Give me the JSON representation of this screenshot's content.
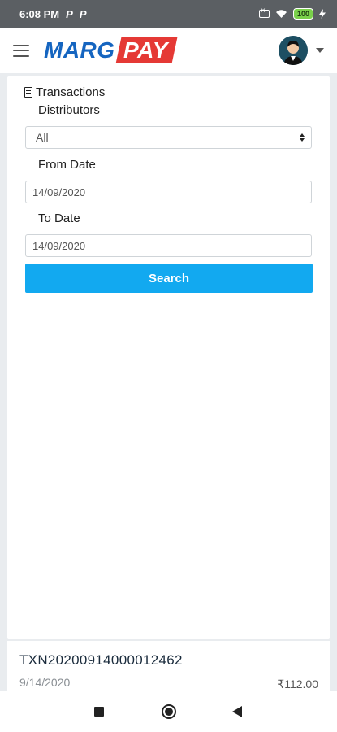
{
  "status_bar": {
    "time": "6:08 PM",
    "notif_marks": [
      "P",
      "P"
    ],
    "battery": "100"
  },
  "header": {
    "logo_left": "MARG",
    "logo_right": "PAY"
  },
  "transactions_form": {
    "title": "Transactions",
    "distributors_label": "Distributors",
    "distributors_value": "All",
    "from_date_label": "From Date",
    "from_date_value": "14/09/2020",
    "to_date_label": "To Date",
    "to_date_value": "14/09/2020",
    "search_label": "Search"
  },
  "transaction_list": [
    {
      "id": "TXN20200914000012462",
      "date": "9/14/2020",
      "amount": "₹112.00"
    }
  ],
  "colors": {
    "accent": "#12a9f0",
    "brand_blue": "#1565c0",
    "brand_red": "#e53935"
  }
}
